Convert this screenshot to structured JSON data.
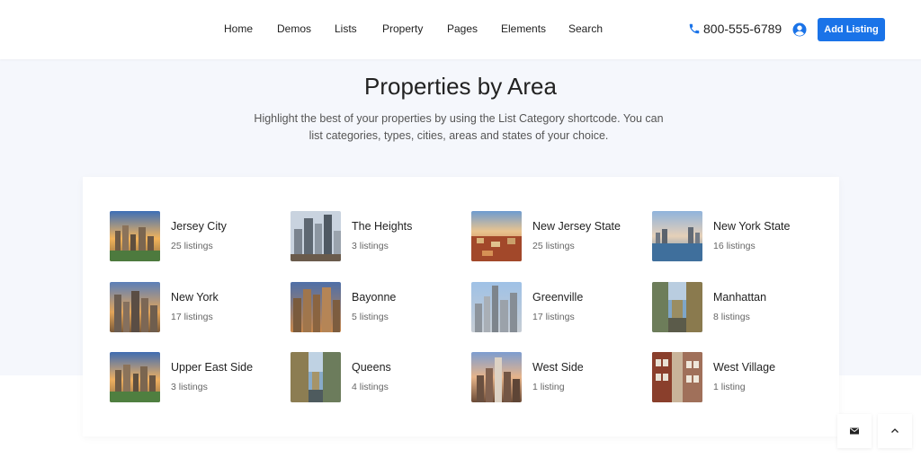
{
  "nav": {
    "items": [
      {
        "label": "Home"
      },
      {
        "label": "Demos"
      },
      {
        "label": "Lists"
      },
      {
        "label": "Property"
      },
      {
        "label": "Pages"
      },
      {
        "label": "Elements"
      },
      {
        "label": "Search"
      }
    ],
    "phone": "800-555-6789",
    "add_listing": "Add Listing"
  },
  "section": {
    "title": "Properties by Area",
    "subtitle": "Highlight the best of your properties by using the List Category shortcode. You can list categories, types, cities, areas and states of your choice."
  },
  "areas": [
    {
      "name": "Jersey City",
      "count": "25 listings"
    },
    {
      "name": "The Heights",
      "count": "3 listings"
    },
    {
      "name": "New Jersey State",
      "count": "25 listings"
    },
    {
      "name": "New York State",
      "count": "16 listings"
    },
    {
      "name": "New York",
      "count": "17 listings"
    },
    {
      "name": "Bayonne",
      "count": "5 listings"
    },
    {
      "name": "Greenville",
      "count": "17 listings"
    },
    {
      "name": "Manhattan",
      "count": "8 listings"
    },
    {
      "name": "Upper East Side",
      "count": "3 listings"
    },
    {
      "name": "Queens",
      "count": "4 listings"
    },
    {
      "name": "West Side",
      "count": "1 listing"
    },
    {
      "name": "West Village",
      "count": "1 listing"
    }
  ],
  "colors": {
    "accent": "#1a73e8",
    "section_bg": "#f5f7fc"
  },
  "icons": {
    "phone": "phone-icon",
    "user": "user-icon",
    "mail": "mail-icon",
    "scroll_top": "chevron-up-icon"
  }
}
